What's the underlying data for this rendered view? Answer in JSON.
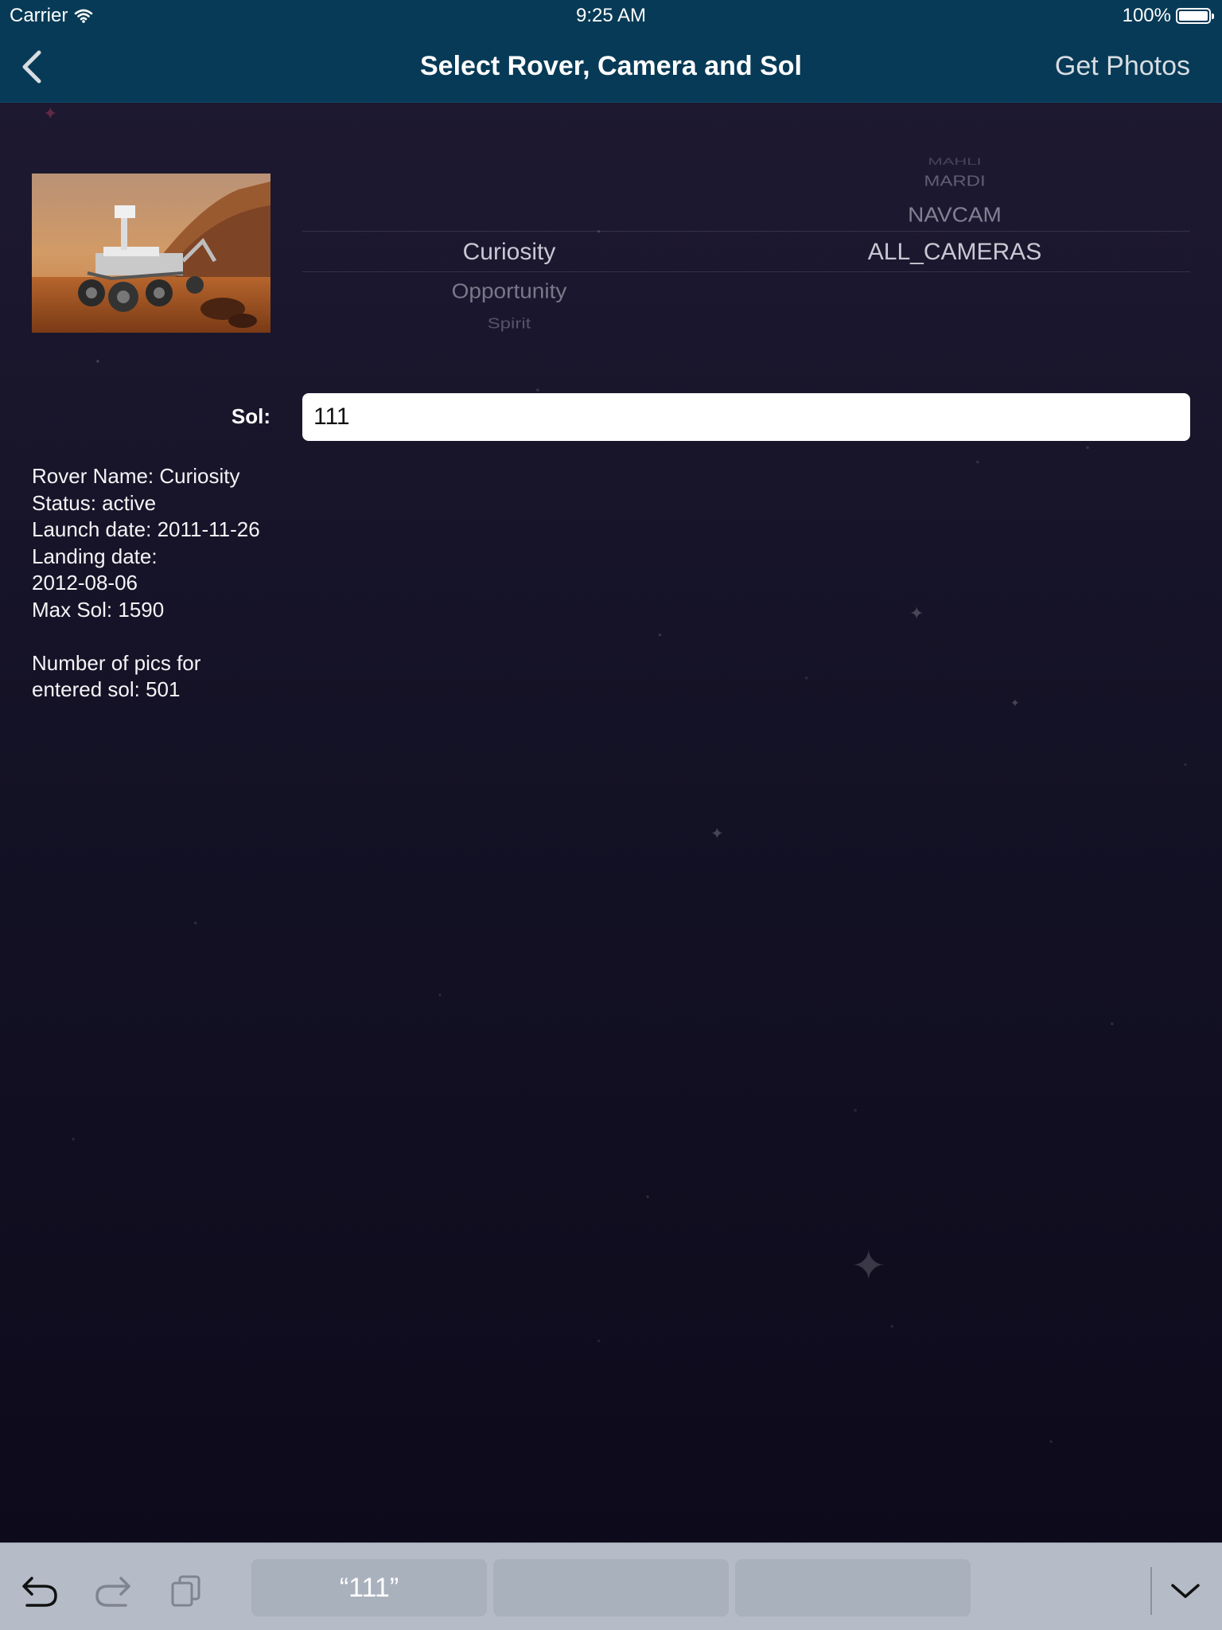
{
  "status_bar": {
    "carrier": "Carrier",
    "time": "9:25 AM",
    "battery": "100%"
  },
  "nav": {
    "title": "Select Rover, Camera and Sol",
    "right_button": "Get Photos",
    "back_icon": "chevron-left-icon"
  },
  "picker": {
    "rovers": [
      "Curiosity",
      "Opportunity",
      "Spirit"
    ],
    "selected_rover": "Curiosity",
    "cameras_above": [
      "MAHLI",
      "MARDI",
      "NAVCAM"
    ],
    "selected_camera": "ALL_CAMERAS"
  },
  "sol": {
    "label": "Sol:",
    "value": "111"
  },
  "rover_info": {
    "name": "Rover Name: Curiosity",
    "status": "Status: active",
    "launch": "Launch date: 2011-11-26",
    "landing_label": "Landing date:",
    "landing_date": "2012-08-06",
    "max_sol": "Max Sol: 1590",
    "pics_line1": "Number of pics for",
    "pics_line2": "entered sol: 501"
  },
  "keyboard_bar": {
    "suggestions": [
      "“111”",
      "",
      ""
    ],
    "icons": [
      "undo-icon",
      "redo-icon",
      "paste-icon",
      "dismiss-keyboard-icon"
    ]
  },
  "colors": {
    "nav_background": "#073a56",
    "page_background": "#1a1730",
    "keyboard_bar": "#b5bcc8"
  }
}
